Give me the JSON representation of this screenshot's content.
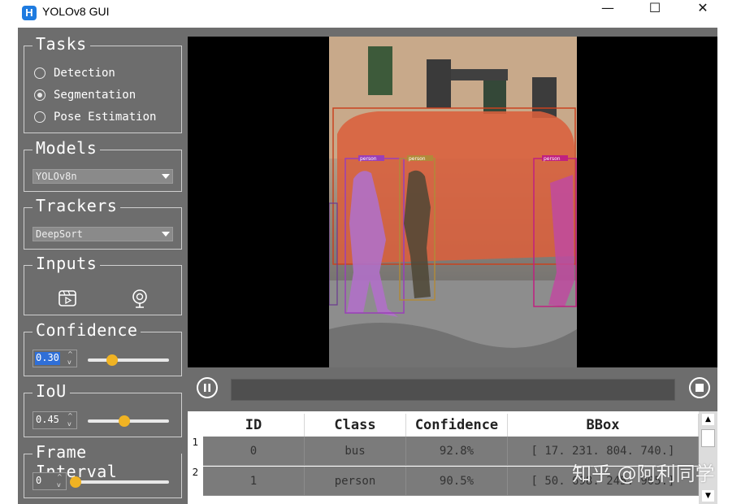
{
  "window": {
    "icon_letter": "H",
    "title": "YOLOv8 GUI",
    "minimize": "—",
    "maximize": "☐",
    "close": "✕"
  },
  "tasks": {
    "title": "Tasks",
    "options": [
      {
        "label": "Detection",
        "checked": false
      },
      {
        "label": "Segmentation",
        "checked": true
      },
      {
        "label": "Pose Estimation",
        "checked": false
      }
    ]
  },
  "models": {
    "title": "Models",
    "selected": "YOLOv8n"
  },
  "trackers": {
    "title": "Trackers",
    "selected": "DeepSort"
  },
  "inputs": {
    "title": "Inputs",
    "video_icon": "video-file-icon",
    "camera_icon": "webcam-icon"
  },
  "confidence": {
    "title": "Confidence",
    "value": "0.30",
    "slider_fraction": 0.3
  },
  "iou": {
    "title": "IoU",
    "value": "0.45",
    "slider_fraction": 0.45
  },
  "frame_interval": {
    "title": "Frame Interval",
    "value": "0",
    "slider_fraction": 0
  },
  "detections": {
    "labels": [
      "person",
      "person",
      "person"
    ]
  },
  "playback": {
    "pause_icon": "pause-icon",
    "stop_icon": "stop-icon"
  },
  "table": {
    "headers": [
      "ID",
      "Class",
      "Confidence",
      "BBox"
    ],
    "rows": [
      {
        "num": "1",
        "id": "0",
        "class": "bus",
        "confidence": "92.8%",
        "bbox": "[ 17.  231. 804. 740.]"
      },
      {
        "num": "2",
        "id": "1",
        "class": "person",
        "confidence": "90.5%",
        "bbox": "[ 50.  698. 245. 905.]"
      }
    ]
  },
  "watermark": "知乎 @阿利同学",
  "colors": {
    "panel_bg": "#6d6d6d",
    "accent_slider": "#f0b323",
    "bus_mask": "#d9603c",
    "person_mask": "#b070c8"
  }
}
